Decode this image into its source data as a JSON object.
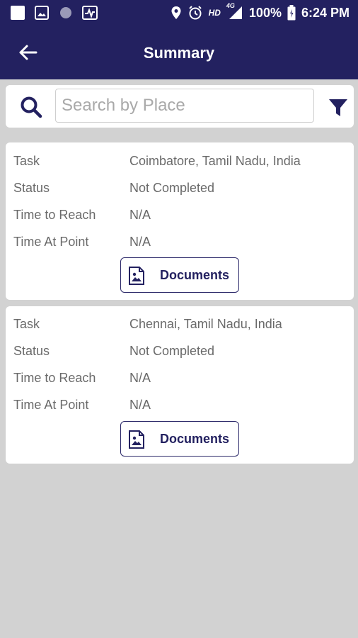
{
  "status_bar": {
    "hd": "HD",
    "network": "4G",
    "battery": "100%",
    "time": "6:24 PM"
  },
  "app_bar": {
    "title": "Summary"
  },
  "search": {
    "placeholder": "Search by Place",
    "value": ""
  },
  "tasks": [
    {
      "task_label": "Task",
      "task_value": "Coimbatore, Tamil Nadu, India",
      "status_label": "Status",
      "status_value": "Not Completed",
      "reach_label": "Time to Reach",
      "reach_value": "N/A",
      "point_label": "Time At Point",
      "point_value": "N/A",
      "documents_label": "Documents"
    },
    {
      "task_label": "Task",
      "task_value": "Chennai, Tamil Nadu, India",
      "status_label": "Status",
      "status_value": "Not Completed",
      "reach_label": "Time to Reach",
      "reach_value": "N/A",
      "point_label": "Time At Point",
      "point_value": "N/A",
      "documents_label": "Documents"
    }
  ],
  "colors": {
    "primary": "#232160",
    "background": "#d2d2d2",
    "card": "#ffffff",
    "text_secondary": "#6a6a6a"
  },
  "icons": [
    "notification-icon",
    "image-icon",
    "circle-icon",
    "activity-icon",
    "location-icon",
    "alarm-icon",
    "signal-icon",
    "battery-icon",
    "back-arrow-icon",
    "search-icon",
    "filter-icon",
    "document-image-icon"
  ]
}
